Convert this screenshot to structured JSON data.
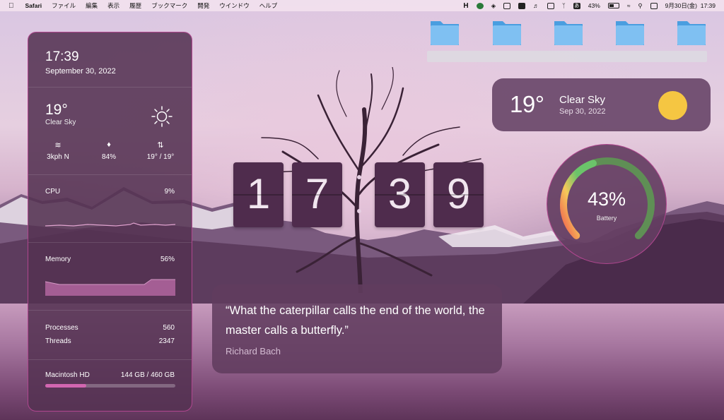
{
  "menubar": {
    "apple": "",
    "app_name": "Safari",
    "menus": [
      "ファイル",
      "編集",
      "表示",
      "履歴",
      "ブックマーク",
      "開発",
      "ウインドウ",
      "ヘルプ"
    ],
    "status_icons": [
      "h-icon",
      "green-status-icon",
      "layers-icon",
      "box-icon",
      "keyboard-icon",
      "volume-icon",
      "display-icon",
      "bluetooth-icon",
      "input-source-icon",
      "battery-icon",
      "wifi-icon",
      "search-icon",
      "control-center-icon"
    ],
    "input_source": "あ",
    "battery_pct": "43%",
    "clock": "9月30日(金)  17:39"
  },
  "panel": {
    "time": "17:39",
    "date": "September 30, 2022",
    "temp": "19°",
    "condition": "Clear Sky",
    "wind": "3kph N",
    "humidity": "84%",
    "minmax": "19° / 19°",
    "cpu_label": "CPU",
    "cpu_value": "9%",
    "memory_label": "Memory",
    "memory_value": "56%",
    "processes_label": "Processes",
    "processes_value": "560",
    "threads_label": "Threads",
    "threads_value": "2347",
    "disk_label": "Macintosh HD",
    "disk_value": "144 GB / 460 GB",
    "disk_used_fraction": 0.313
  },
  "weather_widget": {
    "temp": "19°",
    "condition": "Clear Sky",
    "date": "Sep 30, 2022"
  },
  "battery_gauge": {
    "value": "43%",
    "label": "Battery",
    "fraction": 0.43
  },
  "flip_clock": {
    "digits": [
      "1",
      "7",
      "3",
      "9"
    ]
  },
  "quote": {
    "text": "“What the caterpillar calls the end of the world, the master calls a butterfly.”",
    "author": "Richard Bach"
  },
  "colors": {
    "accent": "#b0468f",
    "sun": "#f5c642",
    "disk_fill": "#d266b0"
  }
}
